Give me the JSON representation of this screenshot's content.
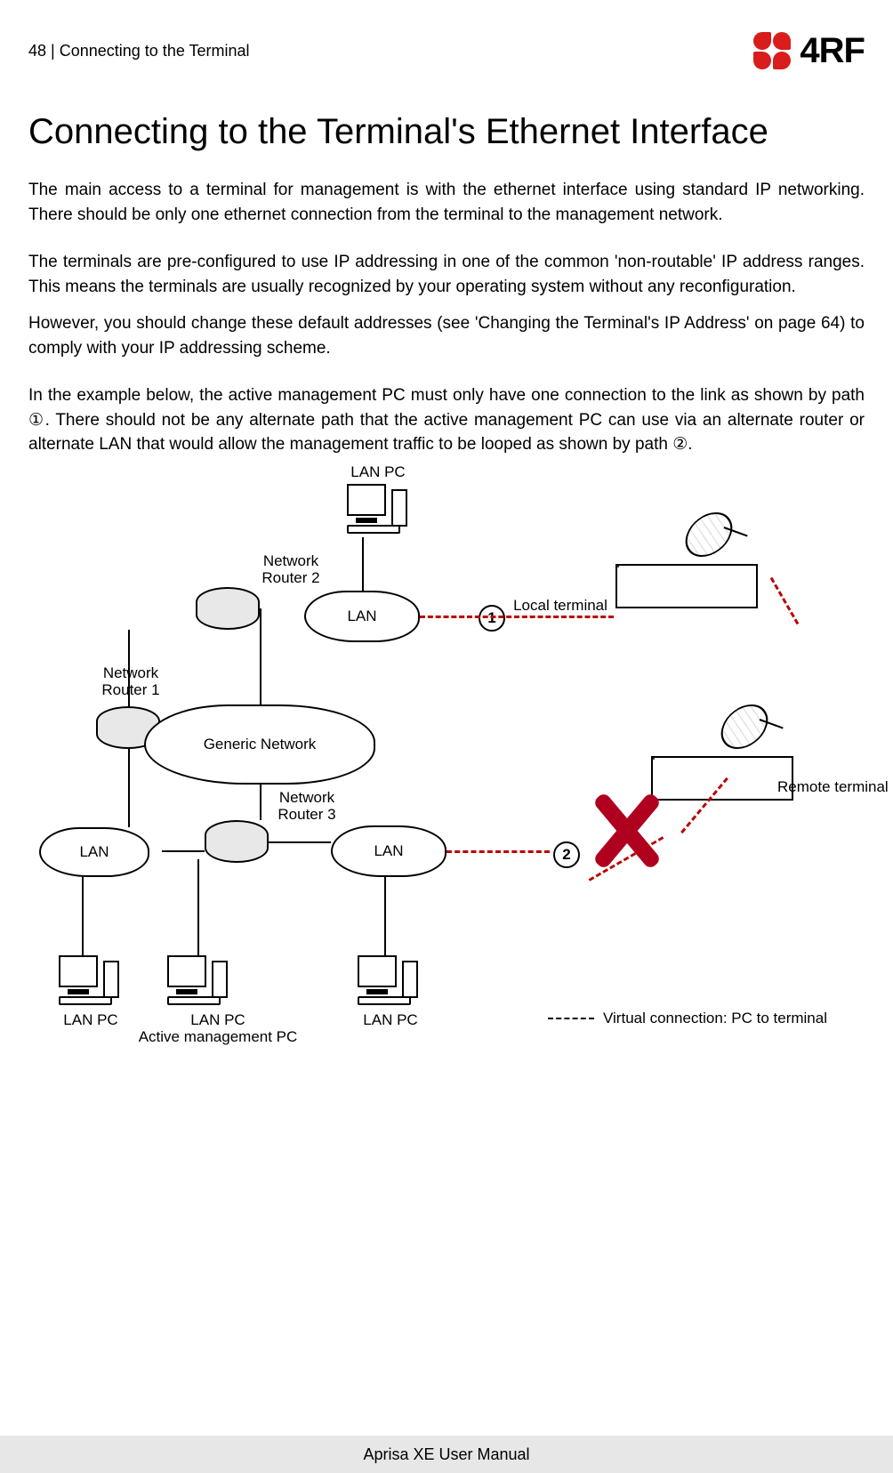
{
  "header": {
    "page_number": "48",
    "section_breadcrumb": "Connecting to the Terminal",
    "brand_name": "4RF"
  },
  "title": "Connecting to the Terminal's Ethernet Interface",
  "paragraphs": {
    "p1": "The main access to a terminal for management is with the ethernet interface using standard IP networking. There should be only one ethernet connection from the terminal to the management network.",
    "p2": "The terminals are pre-configured to use IP addressing in one of the common 'non-routable' IP address ranges. This means the terminals are usually recognized by your operating system without any reconfiguration.",
    "p3": "However, you should change these default addresses (see 'Changing the Terminal's IP Address' on page 64) to comply with your IP addressing scheme.",
    "p4": "In the example below, the active management PC must only have one connection to the link as shown by path ①. There should not be any alternate path that the active management PC can use via an alternate router or alternate LAN that would allow the management traffic to be looped as shown by path ②."
  },
  "diagram": {
    "labels": {
      "lan_pc_top": "LAN PC",
      "router2": "Network\nRouter 2",
      "router1": "Network\nRouter 1",
      "router3": "Network\nRouter 3",
      "lan_left": "LAN",
      "lan_center_top": "LAN",
      "lan_center_mid": "LAN",
      "generic_network": "Generic Network",
      "local_terminal": "Local terminal",
      "remote_terminal": "Remote terminal",
      "lan_pc_bl": "LAN PC",
      "lan_pc_bc_active": "LAN PC\nActive management PC",
      "lan_pc_br": "LAN PC",
      "legend_virtual": "Virtual connection: PC to terminal",
      "path1": "1",
      "path2": "2"
    }
  },
  "footer": {
    "text": "Aprisa XE User Manual"
  }
}
